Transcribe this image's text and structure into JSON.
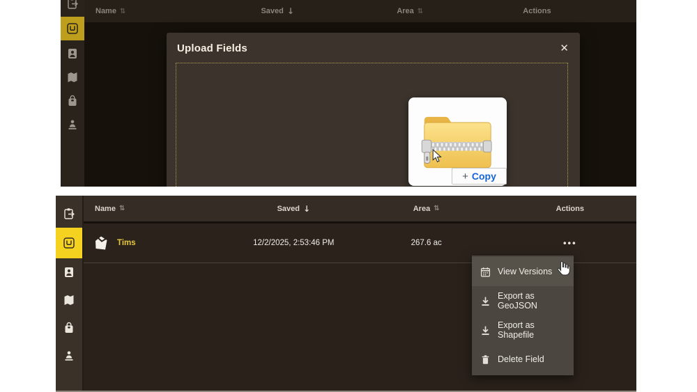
{
  "colors": {
    "accent_yellow": "#f4d21f",
    "row_name_yellow": "#e7c83d",
    "copy_blue": "#1565d8",
    "menu_bg": "#4b4640",
    "modal_bg": "#3b332c"
  },
  "icons": {
    "sort_both": "⇅",
    "sort_desc": "↓",
    "close": "✕",
    "ellipsis": "•••"
  },
  "sidebar": {
    "items": [
      {
        "name": "share-clipboard",
        "selected": false
      },
      {
        "name": "fields",
        "selected": true
      },
      {
        "name": "contacts",
        "selected": false
      },
      {
        "name": "map",
        "selected": false
      },
      {
        "name": "bag",
        "selected": false
      },
      {
        "name": "import-person",
        "selected": false
      }
    ]
  },
  "table": {
    "columns": [
      {
        "label": "Name",
        "sort": "both"
      },
      {
        "label": "Saved",
        "sort": "desc"
      },
      {
        "label": "Area",
        "sort": "both"
      },
      {
        "label": "Actions",
        "sort": "none"
      }
    ],
    "rows": [
      {
        "name": "Tims",
        "saved": "12/2/2025, 2:53:46 PM",
        "area": "267.6 ac"
      }
    ]
  },
  "modal": {
    "title": "Upload Fields",
    "drag_badge": {
      "plus": "+",
      "label": "Copy"
    }
  },
  "context_menu": {
    "items": [
      {
        "label": "View Versions",
        "icon": "calendar-icon",
        "hovered": true
      },
      {
        "label": "Export as GeoJSON",
        "icon": "download-icon",
        "hovered": false
      },
      {
        "label": "Export as Shapefile",
        "icon": "download-icon",
        "hovered": false
      },
      {
        "label": "Delete Field",
        "icon": "trash-icon",
        "hovered": false
      }
    ]
  }
}
